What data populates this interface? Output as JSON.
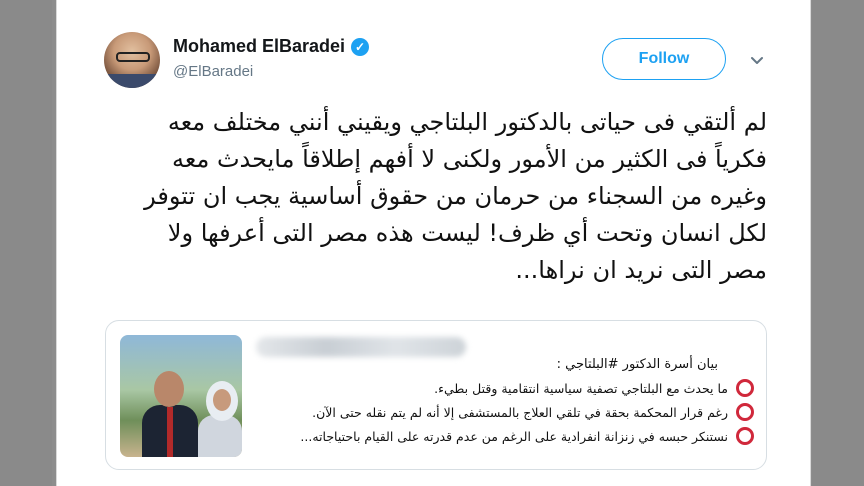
{
  "tweet": {
    "author_name": "Mohamed ElBaradei",
    "handle": "@ElBaradei",
    "follow_label": "Follow",
    "caret_icon": "chevron-down-icon",
    "verified_glyph": "✓",
    "text_lines": [
      "لم ألتقي فى حياتى بالدكتور البلتاجي ويقيني أنني مختلف معه",
      "فكرياً فى الكثير من الأمور ولكنى لا أفهم إطلاقاً مايحدث معه",
      "وغيره من السجناء من حرمان من حقوق أساسية يجب ان تتوفر",
      "لكل انسان وتحت أي ظرف! ليست هذه مصر التى أعرفها ولا",
      "مصر التى نريد ان نراها..."
    ]
  },
  "quote": {
    "heading": "بيان أسرة الدكتور #البلتاجي :",
    "items": [
      "ما يحدث مع البلتاجي تصفية سياسية انتقامية وقتل بطيء.",
      "رغم قرار المحكمة بحقة في تلقي العلاج بالمستشفى إلا أنه لم يتم نقله حتى الآن.",
      "نستنكر حبسه في زنزانة انفرادية على الرغم من عدم قدرته على القيام باحتياجاته..."
    ]
  },
  "colors": {
    "accent": "#1da1f2",
    "ring": "#d0283b",
    "handle": "#657786"
  }
}
